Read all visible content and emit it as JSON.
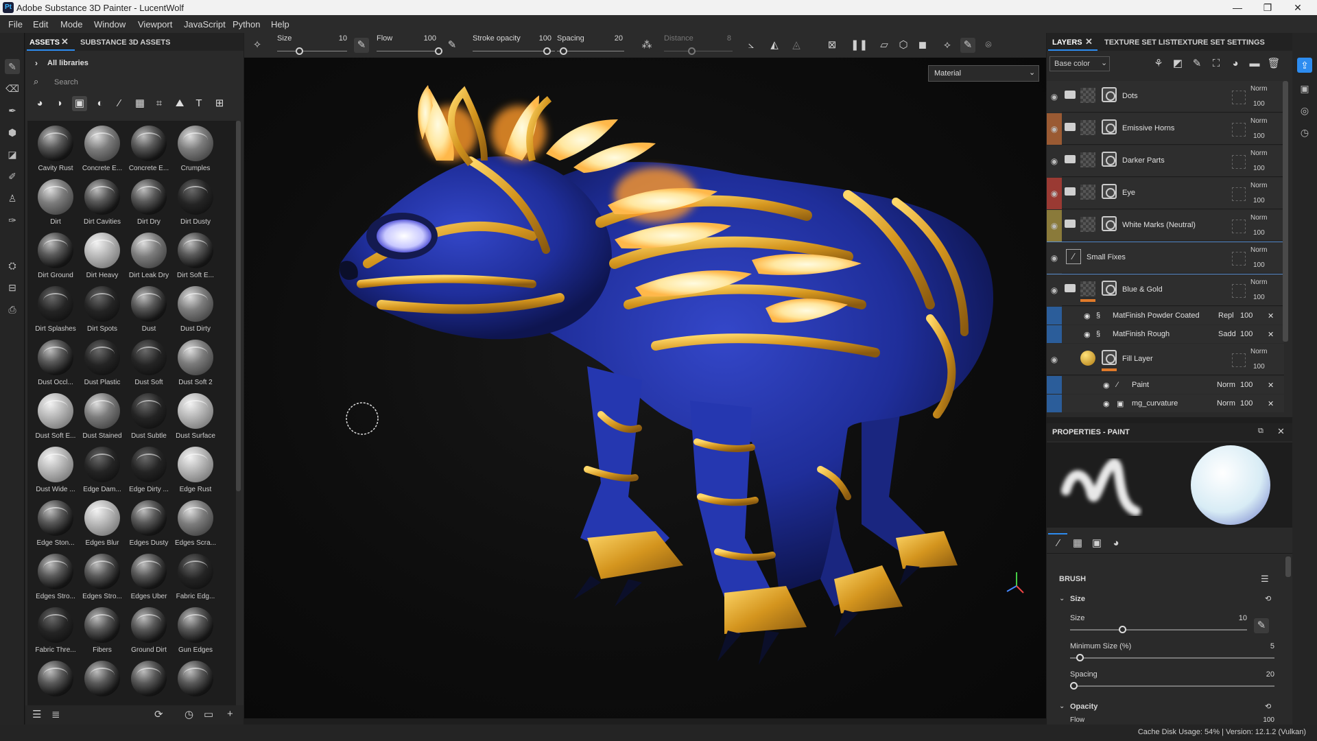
{
  "window": {
    "app_title": "Adobe Substance 3D Painter - LucentWolf",
    "logo": "Pt"
  },
  "menu": [
    "File",
    "Edit",
    "Mode",
    "Window",
    "Viewport",
    "JavaScript",
    "Python",
    "Help"
  ],
  "assets_panel": {
    "tabs": [
      "ASSETS",
      "SUBSTANCE 3D ASSETS"
    ],
    "library": "All libraries",
    "search_placeholder": "Search",
    "items": [
      "Cavity Rust",
      "Concrete E...",
      "Concrete E...",
      "Crumples",
      "Dirt",
      "Dirt Cavities",
      "Dirt Dry",
      "Dirt Dusty",
      "Dirt Ground",
      "Dirt Heavy",
      "Dirt Leak Dry",
      "Dirt Soft E...",
      "Dirt Splashes",
      "Dirt Spots",
      "Dust",
      "Dust Dirty",
      "Dust Occl...",
      "Dust Plastic",
      "Dust Soft",
      "Dust Soft 2",
      "Dust Soft E...",
      "Dust Stained",
      "Dust Subtle",
      "Dust Surface",
      "Dust Wide ...",
      "Edge Dam...",
      "Edge Dirty ...",
      "Edge Rust",
      "Edge Ston...",
      "Edges Blur",
      "Edges Dusty",
      "Edges Scra...",
      "Edges Stro...",
      "Edges Stro...",
      "Edges Uber",
      "Fabric Edg...",
      "Fabric Thre...",
      "Fibers",
      "Ground Dirt",
      "Gun Edges",
      "",
      "",
      "",
      ""
    ]
  },
  "toolbar": {
    "size_label": "Size",
    "size_value": "10",
    "flow_label": "Flow",
    "flow_value": "100",
    "stroke_opacity_label": "Stroke opacity",
    "stroke_opacity_value": "100",
    "spacing_label": "Spacing",
    "spacing_value": "20",
    "distance_label": "Distance",
    "distance_value": "8"
  },
  "viewport": {
    "channel_select": "Material"
  },
  "layers_panel": {
    "tabs": [
      "LAYERS",
      "TEXTURE SET LIST",
      "TEXTURE SET SETTINGS"
    ],
    "channel": "Base color",
    "layers": [
      {
        "name": "Dots",
        "blend": "Norm",
        "opacity": "100",
        "eye_color": "#2e2e2e"
      },
      {
        "name": "Emissive Horns",
        "blend": "Norm",
        "opacity": "100",
        "eye_color": "#9a5a33"
      },
      {
        "name": "Darker Parts",
        "blend": "Norm",
        "opacity": "100",
        "eye_color": "#2e2e2e"
      },
      {
        "name": "Eye",
        "blend": "Norm",
        "opacity": "100",
        "eye_color": "#9a3a33"
      },
      {
        "name": "White Marks (Neutral)",
        "blend": "Norm",
        "opacity": "100",
        "eye_color": "#8a7a3a"
      },
      {
        "name": "Small Fixes",
        "blend": "Norm",
        "opacity": "100",
        "eye_color": "#2e2e2e"
      },
      {
        "name": "Blue & Gold",
        "blend": "Norm",
        "opacity": "100",
        "eye_color": "#2e2e2e"
      }
    ],
    "effects": [
      {
        "name": "MatFinish Powder Coated",
        "blend": "Repl",
        "opacity": "100"
      },
      {
        "name": "MatFinish Rough",
        "blend": "Sadd",
        "opacity": "100"
      }
    ],
    "fill_layer": {
      "name": "Fill Layer",
      "blend": "Norm",
      "opacity": "100"
    },
    "fill_effects": [
      {
        "name": "Paint",
        "blend": "Norm",
        "opacity": "100"
      },
      {
        "name": "mg_curvature",
        "blend": "Norm",
        "opacity": "100"
      }
    ]
  },
  "properties": {
    "title": "PROPERTIES - PAINT",
    "section": "BRUSH",
    "size_group": "Size",
    "size_label": "Size",
    "size_value": "10",
    "size_fraction": 0.3,
    "min_size_label": "Minimum Size (%)",
    "min_size_value": "5",
    "min_size_fraction": 0.05,
    "spacing_label": "Spacing",
    "spacing_value": "20",
    "spacing_fraction": 0.02,
    "opacity_group": "Opacity",
    "flow_label": "Flow",
    "flow_value": "100"
  },
  "status": {
    "text": "Cache Disk Usage:   54% | Version: 12.1.2 (Vulkan)"
  },
  "colors": {
    "accent": "#2d8cf0",
    "gold": "#d8a12a",
    "blue": "#2637a8",
    "glow": "#ffe9a8"
  }
}
